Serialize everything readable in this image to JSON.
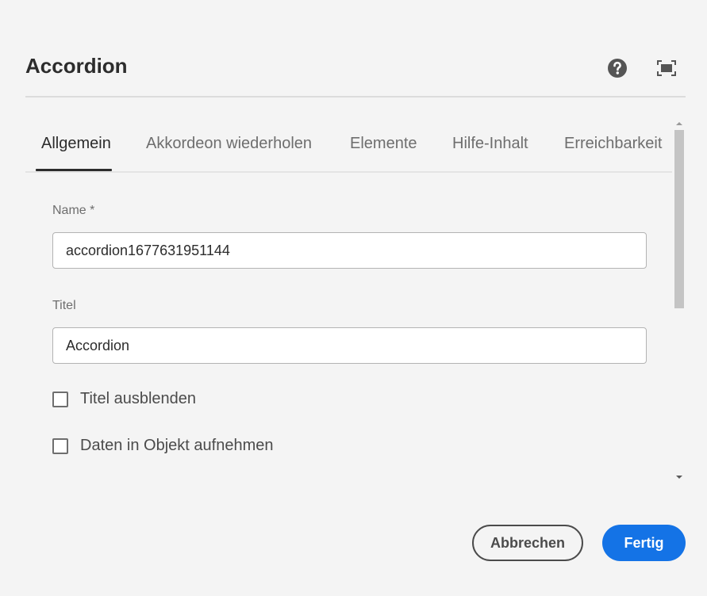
{
  "dialog": {
    "title": "Accordion",
    "help_icon": "help-icon",
    "fullscreen_icon": "fullscreen-icon"
  },
  "tabs": [
    {
      "label": "Allgemein",
      "active": true
    },
    {
      "label": "Akkordeon wiederholen",
      "active": false
    },
    {
      "label": "Elemente",
      "active": false
    },
    {
      "label": "Hilfe-Inhalt",
      "active": false
    },
    {
      "label": "Erreichbarkeit",
      "active": false
    }
  ],
  "form": {
    "name": {
      "label": "Name *",
      "value": "accordion1677631951144"
    },
    "title": {
      "label": "Titel",
      "value": "Accordion"
    },
    "hide_title": {
      "label": "Titel ausblenden",
      "checked": false
    },
    "include_data": {
      "label": "Daten in Objekt aufnehmen",
      "checked": false
    }
  },
  "footer": {
    "cancel_label": "Abbrechen",
    "done_label": "Fertig"
  },
  "colors": {
    "accent": "#1473e6",
    "background": "#f4f4f4",
    "text": "#2c2c2c"
  }
}
